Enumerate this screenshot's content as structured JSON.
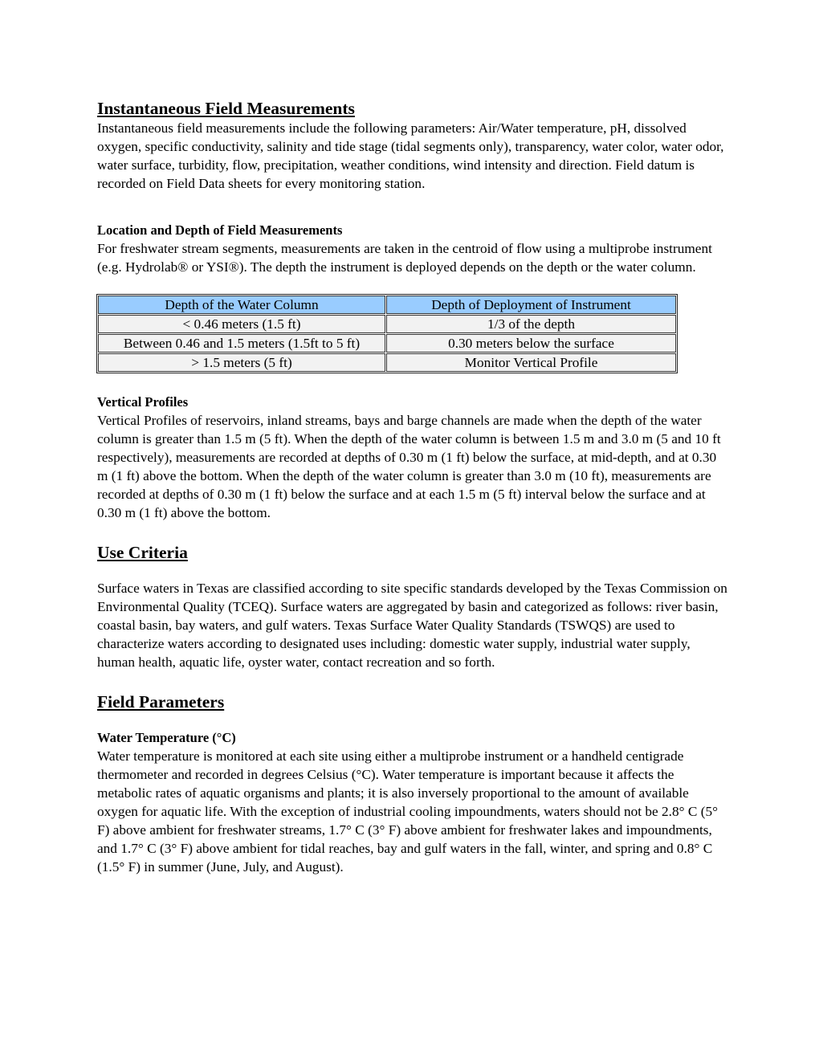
{
  "sections": {
    "instantaneous": {
      "heading": "Instantaneous Field Measurements",
      "body": "Instantaneous field measurements include the following parameters: Air/Water temperature, pH, dissolved oxygen, specific conductivity, salinity and tide stage (tidal segments only), transparency, water color, water odor, water surface, turbidity, flow, precipitation, weather conditions, wind intensity and direction.  Field datum is recorded on Field Data sheets for every monitoring station."
    },
    "location_depth": {
      "heading": "Location and Depth of Field Measurements",
      "body": "For freshwater stream segments, measurements are taken in the centroid of flow using a multiprobe instrument (e.g. Hydrolab® or YSI®).  The depth the instrument is deployed depends on the depth or the water column."
    },
    "depth_table": {
      "headers": [
        "Depth of the Water Column",
        "Depth of Deployment of Instrument"
      ],
      "rows": [
        [
          "< 0.46 meters (1.5 ft)",
          "1/3 of the depth"
        ],
        [
          "Between 0.46 and 1.5 meters (1.5ft to 5 ft)",
          "0.30 meters below the surface"
        ],
        [
          "> 1.5 meters (5 ft)",
          "Monitor Vertical Profile"
        ]
      ],
      "colors": {
        "header_bg": "#99ccff",
        "cell_bg": "#f2f2f2"
      }
    },
    "vertical_profiles": {
      "heading": "Vertical Profiles",
      "body": "Vertical Profiles of reservoirs, inland streams, bays and barge channels are made when the depth of the water column is greater than 1.5 m (5 ft).  When the depth of the water column is between 1.5 m and 3.0 m (5 and 10 ft respectively), measurements are recorded at depths of 0.30 m (1 ft) below the surface, at mid-depth, and at 0.30 m (1 ft) above the bottom.  When the depth of the water column is greater than 3.0 m (10 ft), measurements are recorded at depths of 0.30 m (1 ft) below the surface and at each 1.5 m (5 ft) interval below the surface and at 0.30 m (1 ft) above the bottom."
    },
    "use_criteria": {
      "heading": "Use Criteria",
      "body": "Surface waters in Texas are classified according to site specific standards developed by the Texas Commission on Environmental Quality (TCEQ).  Surface waters are aggregated by basin and categorized as follows:  river basin, coastal basin, bay waters, and gulf waters.  Texas Surface Water Quality Standards (TSWQS) are used to characterize waters according to designated uses including: domestic water supply, industrial water supply, human health, aquatic life, oyster water, contact recreation and so forth."
    },
    "field_parameters": {
      "heading": "Field Parameters"
    },
    "water_temperature": {
      "heading": "Water Temperature (°C)",
      "body": "Water temperature is monitored at each site using either a multiprobe instrument or a handheld centigrade thermometer and recorded in degrees Celsius (°C).   Water temperature is important because it affects the metabolic rates of aquatic organisms and plants; it is also inversely proportional to the amount of available oxygen for aquatic life. With the exception of industrial cooling impoundments, waters should not be 2.8° C (5° F) above ambient for freshwater streams, 1.7° C (3° F) above ambient for freshwater lakes and impoundments, and 1.7° C (3° F) above ambient for tidal reaches, bay and gulf waters in the fall, winter, and spring and 0.8° C (1.5° F) in summer (June, July, and August)."
    }
  }
}
